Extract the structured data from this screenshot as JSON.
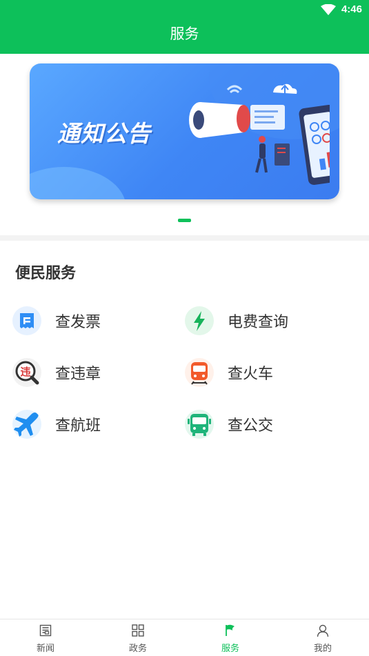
{
  "status_bar": {
    "time": "4:46",
    "icons": [
      "wifi-icon"
    ]
  },
  "header": {
    "title": "服务",
    "color": "#0dc05a"
  },
  "banner": {
    "title": "通知公告",
    "carousel_active_index": 0
  },
  "section": {
    "title": "便民服务",
    "items": [
      {
        "label": "查发票",
        "icon": "invoice-icon"
      },
      {
        "label": "电费查询",
        "icon": "lightning-icon"
      },
      {
        "label": "查违章",
        "icon": "violation-icon"
      },
      {
        "label": "查火车",
        "icon": "train-icon"
      },
      {
        "label": "查航班",
        "icon": "airplane-icon"
      },
      {
        "label": "查公交",
        "icon": "bus-icon"
      }
    ]
  },
  "tabbar": {
    "active": "服务",
    "items": [
      {
        "label": "新闻",
        "icon": "news-icon"
      },
      {
        "label": "政务",
        "icon": "grid-icon"
      },
      {
        "label": "服务",
        "icon": "flag-icon"
      },
      {
        "label": "我的",
        "icon": "person-icon"
      }
    ]
  }
}
